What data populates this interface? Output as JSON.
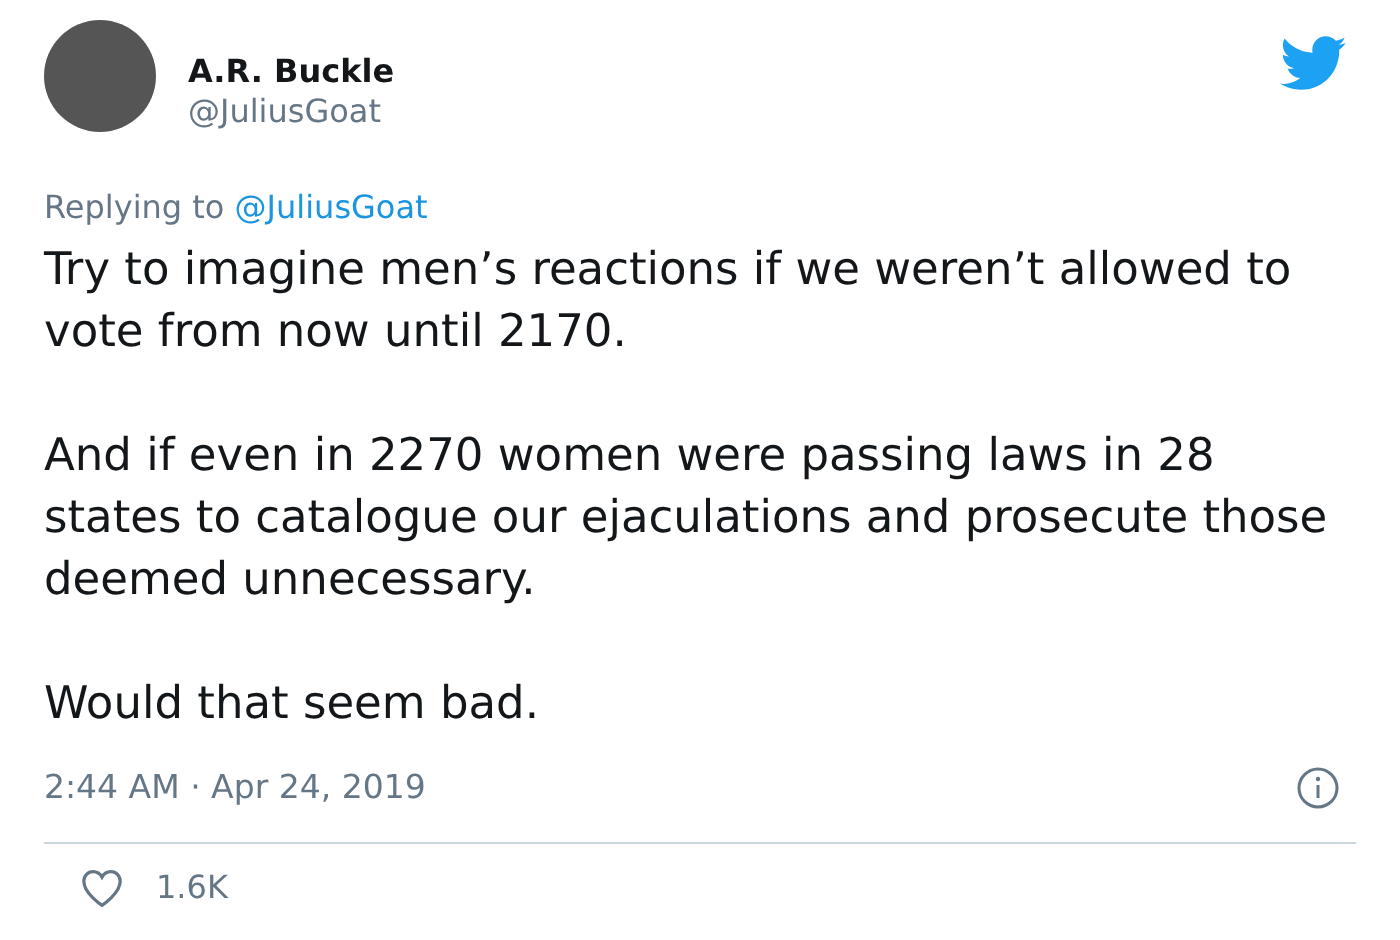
{
  "author": {
    "name": "A.R. Buckle",
    "handle": "@JuliusGoat"
  },
  "replying_to": {
    "prefix": "Replying to",
    "handle": "@JuliusGoat"
  },
  "paragraphs": [
    "Try to imagine men’s reactions if we weren’t allowed to vote from now until 2170.",
    "And if even in 2270 women were passing laws in 28 states to catalogue our ejaculations and prosecute those deemed unnecessary.",
    "Would that seem bad."
  ],
  "timestamp": "2:44 AM · Apr 24, 2019",
  "likes": "1.6K"
}
